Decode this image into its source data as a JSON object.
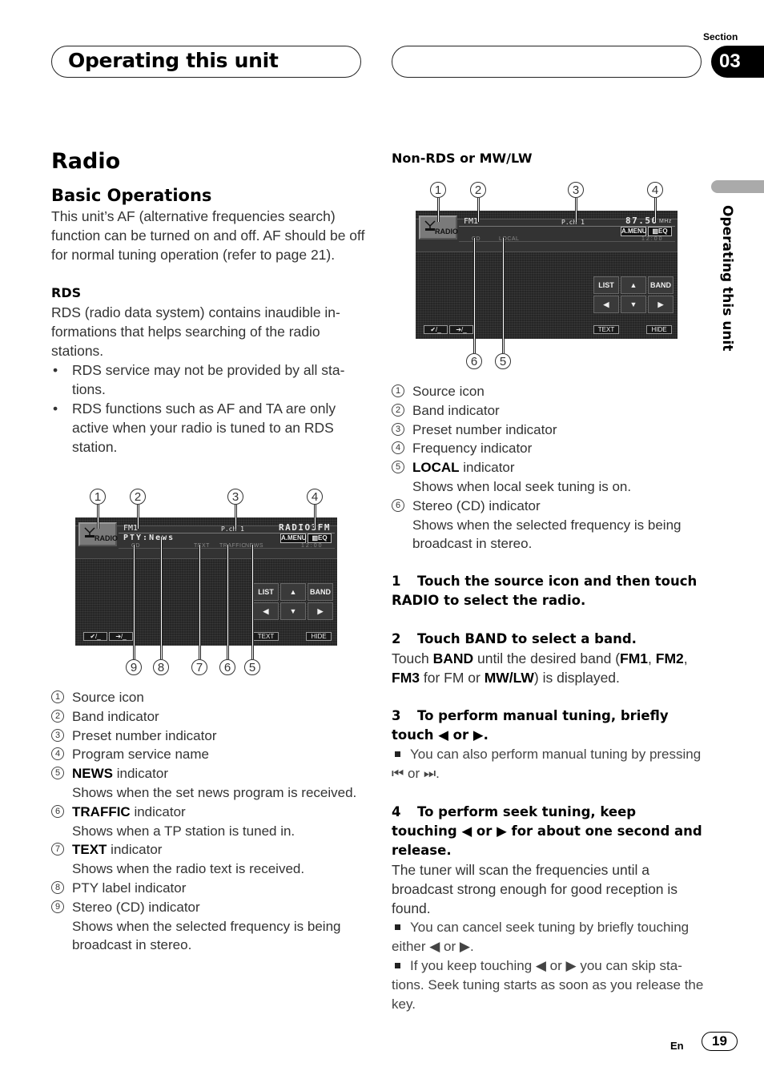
{
  "header": {
    "title": "Operating this unit",
    "section_label": "Section",
    "section_number": "03"
  },
  "side_tab": {
    "label": "Operating this unit"
  },
  "left": {
    "h1": "Radio",
    "h2": "Basic Operations",
    "intro": "This unit’s AF (alternative frequencies search) function can be turned on and off. AF should be off for normal tuning operation (refer to page 21).",
    "rds_heading": "RDS",
    "rds_body": "RDS (radio data system) contains inaudible in­formations that helps searching of the radio stations.",
    "bullet_char": "•",
    "bullets": [
      "RDS service may not be provided by all sta­tions.",
      "RDS functions such as AF and TA are only active when your radio is tuned to an RDS station."
    ],
    "diagram": {
      "callouts_top": [
        "1",
        "2",
        "3",
        "4"
      ],
      "callouts_bottom": [
        "9",
        "8",
        "7",
        "6",
        "5"
      ],
      "screen": {
        "source_label": "RADIO",
        "band": "FM1",
        "preset": "P.ch 1",
        "ps_name": "RADIO3FM",
        "pty": "PTY:News",
        "a_menu": "A.MENU",
        "eq": "EQ",
        "stereo": "CD",
        "text_ind": "TEXT",
        "traffic_ind": "TRAFFIC",
        "news_ind": "NEWS",
        "clock": "12:00",
        "pad": {
          "list": "LIST",
          "up": "▲",
          "band": "BAND",
          "left": "◀",
          "down": "▼",
          "right": "▶"
        },
        "foot_left_1": "✔/_",
        "foot_left_2": "➔/_",
        "text_btn": "TEXT",
        "hide_btn": "HIDE"
      }
    },
    "legend": [
      {
        "n": "1",
        "bold": "",
        "text": "Source icon",
        "desc": ""
      },
      {
        "n": "2",
        "bold": "",
        "text": "Band indicator",
        "desc": ""
      },
      {
        "n": "3",
        "bold": "",
        "text": "Preset number indicator",
        "desc": ""
      },
      {
        "n": "4",
        "bold": "",
        "text": "Program service name",
        "desc": ""
      },
      {
        "n": "5",
        "bold": "NEWS",
        "text": " indicator",
        "desc": "Shows when the set news program is re­ceived."
      },
      {
        "n": "6",
        "bold": "TRAFFIC",
        "text": " indicator",
        "desc": "Shows when a TP station is tuned in."
      },
      {
        "n": "7",
        "bold": "TEXT",
        "text": " indicator",
        "desc": "Shows when the radio text is received."
      },
      {
        "n": "8",
        "bold": "",
        "text": "PTY label indicator",
        "desc": ""
      },
      {
        "n": "9",
        "bold": "",
        "text": "Stereo (CD) indicator",
        "desc": "Shows when the selected frequency is being broadcast in stereo."
      }
    ]
  },
  "right": {
    "heading": "Non-RDS or MW/LW",
    "diagram": {
      "callouts_top": [
        "1",
        "2",
        "3",
        "4"
      ],
      "callouts_bottom": [
        "6",
        "5"
      ],
      "screen": {
        "source_label": "RADIO",
        "band": "FM1",
        "preset": "P.ch 1",
        "frequency": "87.50",
        "freq_unit": "MHz",
        "a_menu": "A.MENU",
        "eq": "EQ",
        "stereo": "CD",
        "local_ind": "LOCAL",
        "clock": "12:00",
        "pad": {
          "list": "LIST",
          "up": "▲",
          "band": "BAND",
          "left": "◀",
          "down": "▼",
          "right": "▶"
        },
        "foot_left_1": "✔/_",
        "foot_left_2": "➔/_",
        "text_btn": "TEXT",
        "hide_btn": "HIDE"
      }
    },
    "legend": [
      {
        "n": "1",
        "bold": "",
        "text": "Source icon",
        "desc": ""
      },
      {
        "n": "2",
        "bold": "",
        "text": "Band indicator",
        "desc": ""
      },
      {
        "n": "3",
        "bold": "",
        "text": "Preset number indicator",
        "desc": ""
      },
      {
        "n": "4",
        "bold": "",
        "text": "Frequency indicator",
        "desc": ""
      },
      {
        "n": "5",
        "bold": "LOCAL",
        "text": " indicator",
        "desc": "Shows when local seek tuning is on."
      },
      {
        "n": "6",
        "bold": "",
        "text": "Stereo (CD) indicator",
        "desc": "Shows when the selected frequency is being broadcast in stereo."
      }
    ],
    "steps": [
      {
        "n": "1",
        "title": "Touch the source icon and then touch RADIO to select the radio."
      },
      {
        "n": "2",
        "title": "Touch BAND to select a band.",
        "body_parts": [
          {
            "t": "Touch ",
            "b": false
          },
          {
            "t": "BAND",
            "b": true
          },
          {
            "t": " until the desired band (",
            "b": false
          },
          {
            "t": "FM1",
            "b": true
          },
          {
            "t": ", ",
            "b": false
          },
          {
            "t": "FM2",
            "b": true
          },
          {
            "t": ", ",
            "b": false
          },
          {
            "t": "FM3",
            "b": true
          },
          {
            "t": " for FM or ",
            "b": false
          },
          {
            "t": "MW/LW",
            "b": true
          },
          {
            "t": ") is displayed.",
            "b": false
          }
        ]
      },
      {
        "n": "3",
        "title": "To perform manual tuning, briefly touch ◀ or ▶.",
        "notes": [
          "You can also perform manual tuning by press­ing ⏮ or ⏭."
        ]
      },
      {
        "n": "4",
        "title": "To perform seek tuning, keep touching ◀ or ▶ for about one second and release.",
        "body": "The tuner will scan the frequencies until a broadcast strong enough for good reception is found.",
        "notes": [
          "You can cancel seek tuning by briefly touching either ◀ or ▶.",
          "If you keep touching ◀ or ▶ you can skip sta­tions. Seek tuning starts as soon as you release the key."
        ]
      }
    ]
  },
  "footer": {
    "lang": "En",
    "page": "19"
  }
}
